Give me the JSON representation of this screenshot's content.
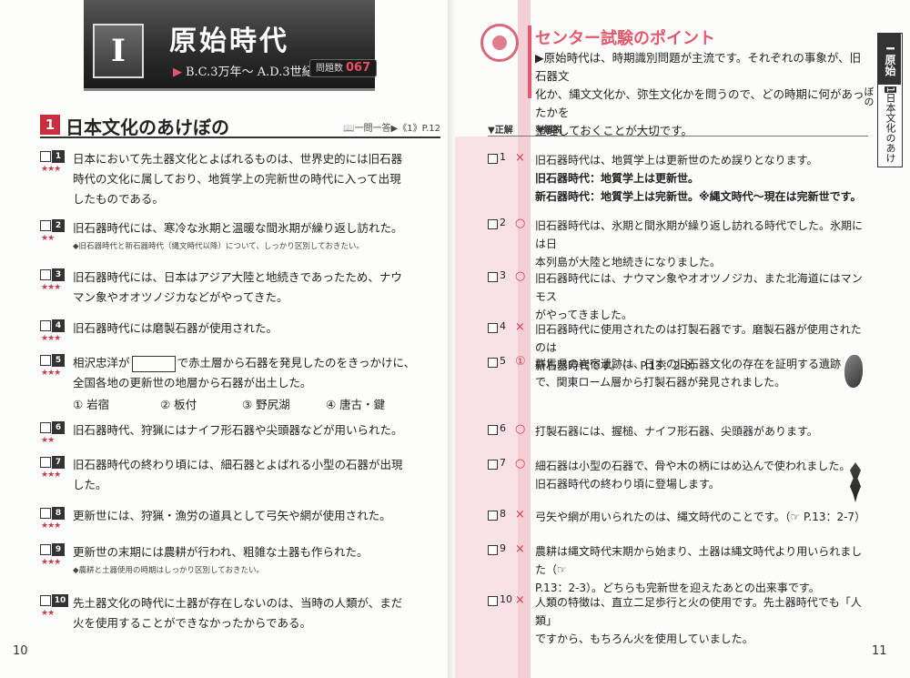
{
  "left_page": {
    "chapter": {
      "roman": "I",
      "title": "原始時代",
      "period": "B.C.3万年～ A.D.3世紀頃",
      "count_label": "問題数",
      "count_value": "067"
    },
    "section": {
      "number": "1",
      "title": "日本文化のあけぼの",
      "reference": "一問一答▶《1》P.12"
    },
    "questions": [
      {
        "num": "1",
        "stars": "★★★",
        "lines": [
          "日本において先土器文化とよばれるものは、世界史的には旧石器",
          "時代の文化に属しており、地質学上の完新世の時代に入って出現",
          "したものである。"
        ]
      },
      {
        "num": "2",
        "stars": "★★",
        "lines": [
          "旧石器時代には、寒冷な氷期と温暖な間氷期が繰り返し訪れた。"
        ],
        "note": "◆旧石器時代と新石器時代（縄文時代以降）について、しっかり区別しておきたい。"
      },
      {
        "num": "3",
        "stars": "★★★",
        "lines": [
          "旧石器時代には、日本はアジア大陸と地続きであったため、ナウ",
          "マン象やオオツノジカなどがやってきた。"
        ]
      },
      {
        "num": "4",
        "stars": "★★★",
        "lines": [
          "旧石器時代には磨製石器が使用された。"
        ]
      },
      {
        "num": "5",
        "stars": "★★★",
        "line1_pre": "相沢忠洋が",
        "line1_post": "で赤土層から石器を発見したのをきっかけに、",
        "lines": [
          "全国各地の更新世の地層から石器が出土した。"
        ],
        "choices": [
          "① 岩宿",
          "② 板付",
          "③ 野尻湖",
          "④ 唐古・鍵"
        ]
      },
      {
        "num": "6",
        "stars": "★★",
        "lines": [
          "旧石器時代、狩猟にはナイフ形石器や尖頭器などが用いられた。"
        ]
      },
      {
        "num": "7",
        "stars": "★★★",
        "lines": [
          "旧石器時代の終わり頃には、細石器とよばれる小型の石器が出現",
          "した。"
        ]
      },
      {
        "num": "8",
        "stars": "★★★",
        "lines": [
          "更新世には、狩猟・漁労の道具として弓矢や網が使用された。"
        ]
      },
      {
        "num": "9",
        "stars": "★★★",
        "lines": [
          "更新世の末期には農耕が行われ、粗雑な土器も作られた。"
        ],
        "note": "◆農耕と土器使用の時期はしっかり区別しておきたい。"
      },
      {
        "num": "10",
        "stars": "★★",
        "lines": [
          "先土器文化の時代に土器が存在しないのは、当時の人類が、まだ",
          "火を使用することができなかったからである。"
        ]
      }
    ],
    "page_number": "10"
  },
  "right_page": {
    "point": {
      "title": "センター試験のポイント",
      "lines": [
        "▶原始時代は、時期識別問題が主流です。それぞれの事象が、旧石器文",
        "化か、縄文文化か、弥生文化かを問うので、どの時期に何があったかを",
        "整理しておくことが大切です。"
      ]
    },
    "headers": {
      "answer": "▼正解",
      "explanation": "▼解説"
    },
    "side_tab": {
      "top": "I 原始",
      "sub": "日本文化のあけぼの",
      "sub_num": "1"
    },
    "answers": [
      {
        "num": "1",
        "mark": "×",
        "lines": [
          "旧石器時代は、地質学上は更新世のため誤りとなります。",
          "旧石器時代：地質学上は更新世。",
          "新石器時代：地質学上は完新世。※縄文時代～現在は完新世です。"
        ]
      },
      {
        "num": "2",
        "mark": "○",
        "lines": [
          "旧石器時代は、氷期と間氷期が繰り返し訪れる時代でした。氷期には日",
          "本列島が大陸と地続きになりました。"
        ]
      },
      {
        "num": "3",
        "mark": "○",
        "lines": [
          "旧石器時代には、ナウマン象やオオツノジカ、また北海道にはマンモス",
          "がやってきました。"
        ]
      },
      {
        "num": "4",
        "mark": "×",
        "lines": [
          "旧石器時代に使用されたのは打製石器です。磨製石器が使用されたのは",
          "新石器時代です。（☞ P.13：2-3）"
        ]
      },
      {
        "num": "5",
        "mark": "①",
        "lines": [
          "群馬県の岩宿遺跡は、日本の旧石器文化の存在を証明する遺跡",
          "で、関東ローム層から打製石器が発見されました。"
        ]
      },
      {
        "num": "6",
        "mark": "○",
        "lines": [
          "打製石器には、握槌、ナイフ形石器、尖頭器があります。"
        ]
      },
      {
        "num": "7",
        "mark": "○",
        "lines": [
          "細石器は小型の石器で、骨や木の柄にはめ込んで使われました。",
          "旧石器時代の終わり頃に登場します。"
        ]
      },
      {
        "num": "8",
        "mark": "×",
        "lines": [
          "弓矢や網が用いられたのは、縄文時代のことです。（☞ P.13：2-7）"
        ]
      },
      {
        "num": "9",
        "mark": "×",
        "lines": [
          "農耕は縄文時代末期から始まり、土器は縄文時代より用いられました（☞",
          "P.13：2-3）。どちらも完新世を迎えたあとの出来事です。"
        ]
      },
      {
        "num": "10",
        "mark": "×",
        "lines": [
          "人類の特徴は、直立二足歩行と火の使用です。先土器時代でも「人類」",
          "ですから、もちろん火を使用していました。"
        ]
      }
    ],
    "page_number": "11"
  }
}
